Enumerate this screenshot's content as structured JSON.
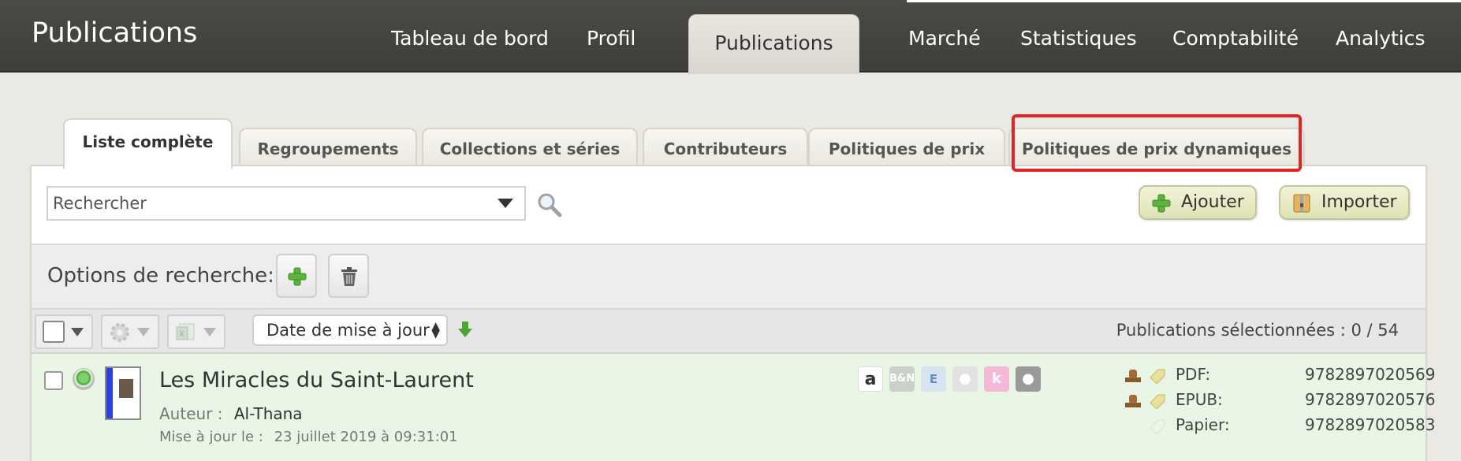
{
  "app": {
    "title": "Publications"
  },
  "nav": {
    "items": [
      {
        "label": "Tableau de bord"
      },
      {
        "label": "Profil"
      },
      {
        "label": "Publications"
      },
      {
        "label": "Marché"
      },
      {
        "label": "Statistiques"
      },
      {
        "label": "Comptabilité"
      },
      {
        "label": "Analytics"
      }
    ],
    "active_index": 2
  },
  "subtabs": {
    "items": [
      {
        "label": "Liste complète"
      },
      {
        "label": "Regroupements"
      },
      {
        "label": "Collections et séries"
      },
      {
        "label": "Contributeurs"
      },
      {
        "label": "Politiques de prix"
      },
      {
        "label": "Politiques de prix dynamiques"
      }
    ],
    "active_index": 0,
    "highlighted_index": 5,
    "highlight_color": "#e02525"
  },
  "search": {
    "placeholder": "Rechercher",
    "add_button": "Ajouter",
    "import_button": "Importer"
  },
  "options": {
    "label": "Options de recherche:"
  },
  "toolbar": {
    "sort_value": "Date de mise à jour",
    "selected_text": "Publications sélectionnées : 0 / 54"
  },
  "publications": [
    {
      "title": "Les Miracles du Saint-Laurent",
      "author_label": "Auteur :",
      "author": "Al-Thana",
      "updated_label": "Mise à jour le :",
      "updated": "23 juillet 2019 à 09:31:01",
      "status_color": "#5cb447",
      "stores": [
        "amazon-icon",
        "barnes-noble-icon",
        "e-store-icon",
        "apple-icon",
        "kobo-icon",
        "apple-books-icon"
      ],
      "formats": [
        {
          "label": "PDF:",
          "isbn": "9782897020569"
        },
        {
          "label": "EPUB:",
          "isbn": "9782897020576"
        },
        {
          "label": "Papier:",
          "isbn": "9782897020583"
        }
      ]
    }
  ],
  "colors": {
    "topbar": "#454440",
    "row_bg": "#e9f6e5",
    "button_bg": "#e6e8c4"
  }
}
